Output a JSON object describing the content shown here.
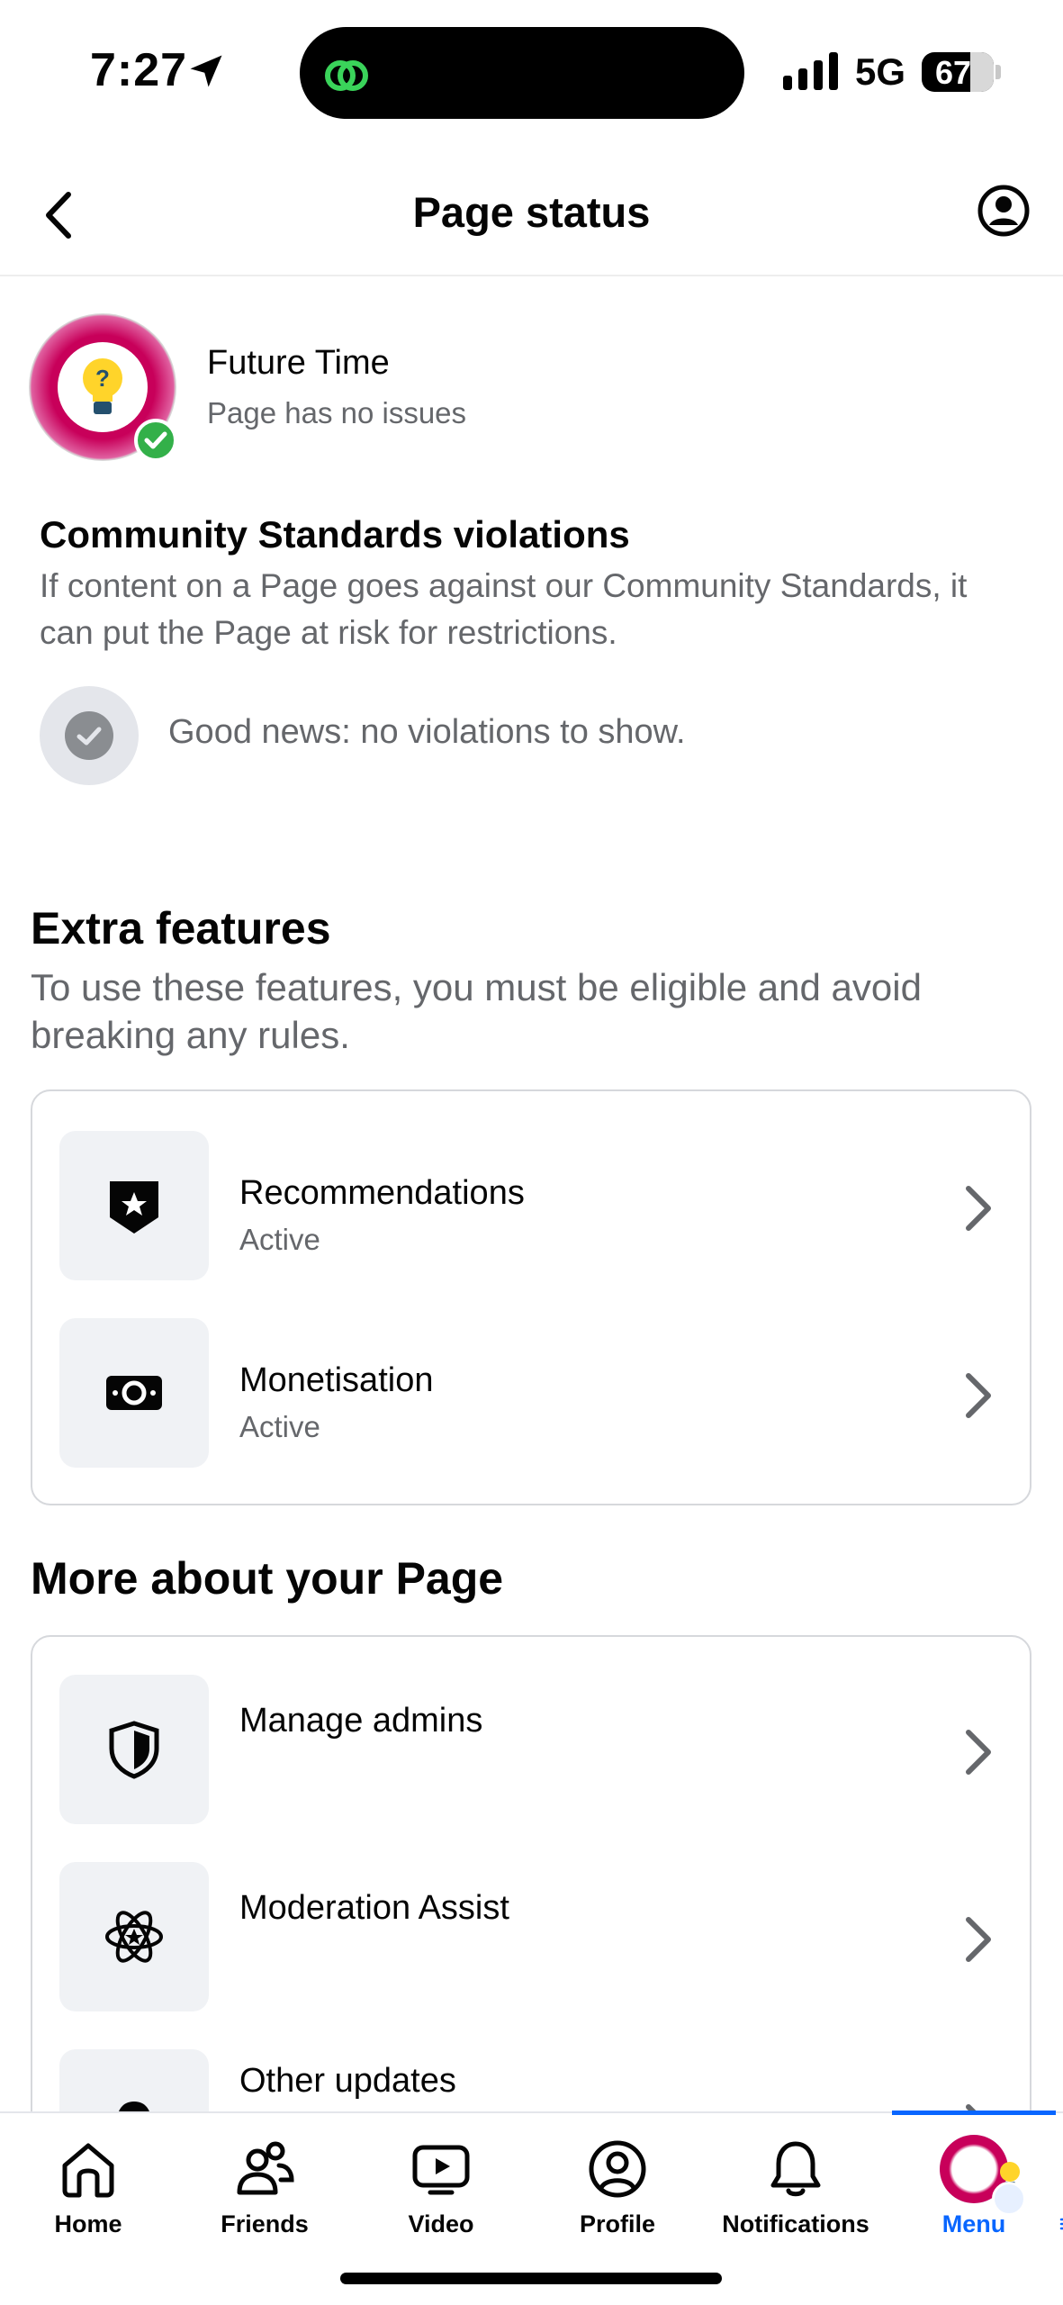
{
  "status_bar": {
    "time": "7:27",
    "network": "5G",
    "battery_percent": "67",
    "battery_level": 0.67
  },
  "header": {
    "title": "Page status"
  },
  "page": {
    "name": "Future Time",
    "health": "Page has no issues"
  },
  "community_standards": {
    "title": "Community Standards violations",
    "description": "If content on a Page goes against our Community Standards, it can put the Page at risk for restrictions.",
    "good_news": "Good news: no violations to show."
  },
  "extra_features": {
    "title": "Extra features",
    "description": "To use these features, you must be eligible and avoid breaking any rules.",
    "items": [
      {
        "label": "Recommendations",
        "status": "Active",
        "icon": "shield-star-icon"
      },
      {
        "label": "Monetisation",
        "status": "Active",
        "icon": "money-icon"
      }
    ]
  },
  "more_about": {
    "title": "More about your Page",
    "items": [
      {
        "label": "Manage admins",
        "icon": "shield-icon"
      },
      {
        "label": "Moderation Assist",
        "icon": "atom-star-icon"
      },
      {
        "label": "Other updates",
        "icon": "bell-icon"
      }
    ]
  },
  "tabbar": {
    "items": [
      {
        "label": "Home",
        "icon": "home-icon"
      },
      {
        "label": "Friends",
        "icon": "friends-icon"
      },
      {
        "label": "Video",
        "icon": "video-icon"
      },
      {
        "label": "Profile",
        "icon": "profile-icon"
      },
      {
        "label": "Notifications",
        "icon": "bell-icon"
      },
      {
        "label": "Menu",
        "icon": "menu-avatar-icon",
        "active": true
      }
    ]
  },
  "colors": {
    "accent": "#0866ff",
    "success": "#33b049",
    "secondary_text": "#65676b",
    "avatar_ring": "#c8005a"
  }
}
